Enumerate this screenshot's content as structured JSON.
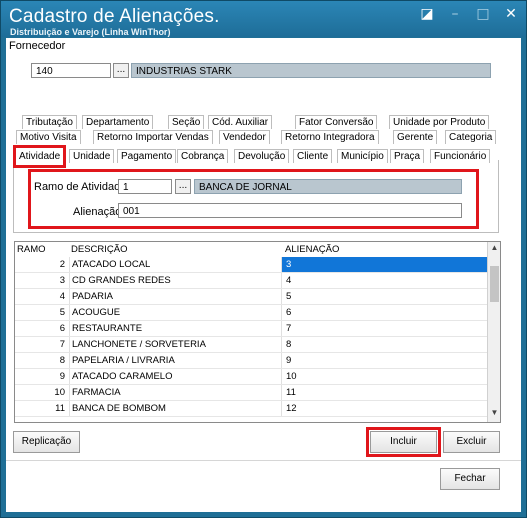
{
  "window": {
    "title": "Cadastro de Alienações.",
    "subtitle": "Distribuição e Varejo (Linha WinThor)",
    "controls": [
      "restore-icon",
      "minimize-icon",
      "maximize-icon",
      "close-icon"
    ]
  },
  "fornecedor": {
    "label": "Fornecedor",
    "code": "140",
    "lookup_label": "...",
    "name": "INDUSTRIAS STARK"
  },
  "tabs": {
    "row1": [
      "Tributação",
      "Departamento",
      "Seção",
      "Cód. Auxiliar",
      "Fator Conversão",
      "Unidade por Produto"
    ],
    "row2": [
      "Motivo Visita",
      "Retorno Importar Vendas",
      "Vendedor",
      "Retorno Integradora",
      "Gerente",
      "Categoria"
    ],
    "row3": [
      "Atividade",
      "Unidade",
      "Pagamento",
      "Cobrança",
      "Devolução",
      "Cliente",
      "Município",
      "Praça",
      "Funcionário"
    ],
    "active": "Atividade"
  },
  "form": {
    "ramo_label": "Ramo de Atividade",
    "ramo_value": "1",
    "ramo_lookup": "...",
    "ramo_desc": "BANCA DE JORNAL",
    "alienacao_label": "Alienação",
    "alienacao_value": "001"
  },
  "grid": {
    "headers": [
      "RAMO",
      "DESCRIÇÃO",
      "ALIENAÇÃO"
    ],
    "rows": [
      [
        "2",
        "ATACADO LOCAL",
        "3"
      ],
      [
        "3",
        "CD GRANDES REDES",
        "4"
      ],
      [
        "4",
        "PADARIA",
        "5"
      ],
      [
        "5",
        "ACOUGUE",
        "6"
      ],
      [
        "6",
        "RESTAURANTE",
        "7"
      ],
      [
        "7",
        "LANCHONETE / SORVETERIA",
        "8"
      ],
      [
        "8",
        "PAPELARIA / LIVRARIA",
        "9"
      ],
      [
        "9",
        "ATACADO CARAMELO",
        "10"
      ],
      [
        "10",
        "FARMACIA",
        "11"
      ],
      [
        "11",
        "BANCA DE BOMBOM",
        "12"
      ]
    ],
    "selected_row": 0
  },
  "buttons": {
    "replicacao": "Replicação",
    "incluir": "Incluir",
    "excluir": "Excluir",
    "fechar": "Fechar"
  },
  "colors": {
    "title_bar": "#1e6d98",
    "highlight": "#e0161b",
    "selection": "#1176d8"
  }
}
